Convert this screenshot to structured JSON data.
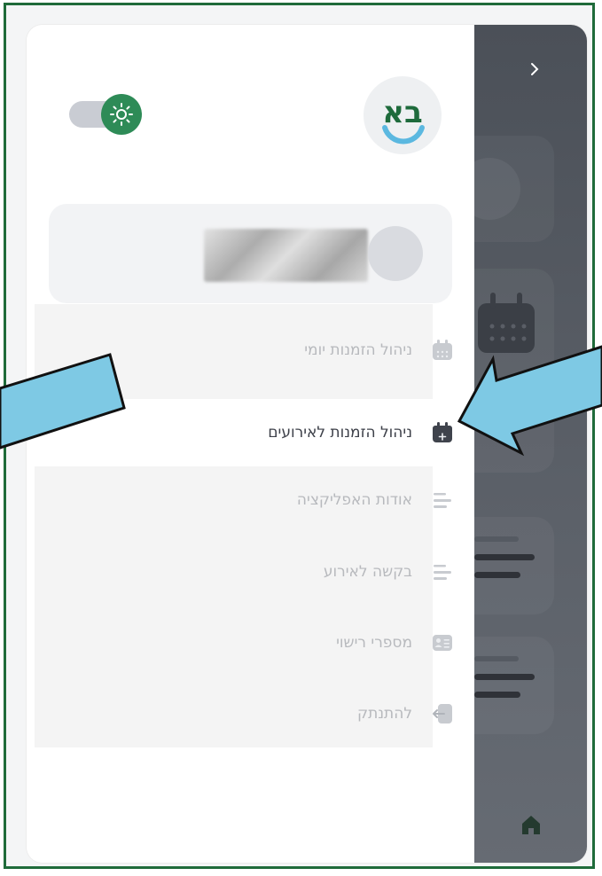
{
  "menu": {
    "items": [
      {
        "label": "ניהול הזמנות יומי",
        "icon": "calendar-grid-icon",
        "active": false
      },
      {
        "label": "ניהול הזמנות לאירועים",
        "icon": "calendar-plus-icon",
        "active": true
      },
      {
        "label": "אודות האפליקציה",
        "icon": "lines-icon",
        "active": false
      },
      {
        "label": "בקשה לאירוע",
        "icon": "lines-icon",
        "active": false
      },
      {
        "label": "מספרי רישוי",
        "icon": "id-card-icon",
        "active": false
      },
      {
        "label": "להתנתק",
        "icon": "logout-icon",
        "active": false
      }
    ]
  },
  "logo": {
    "text": "בא"
  },
  "theme_toggle": {
    "state": "on",
    "icon": "sun-icon"
  },
  "colors": {
    "accent": "#2e8b57",
    "frame": "#1f6b3a",
    "arrow": "#7ec9e4",
    "active_text": "#3d4049",
    "inactive_text": "#b7b9bd"
  }
}
